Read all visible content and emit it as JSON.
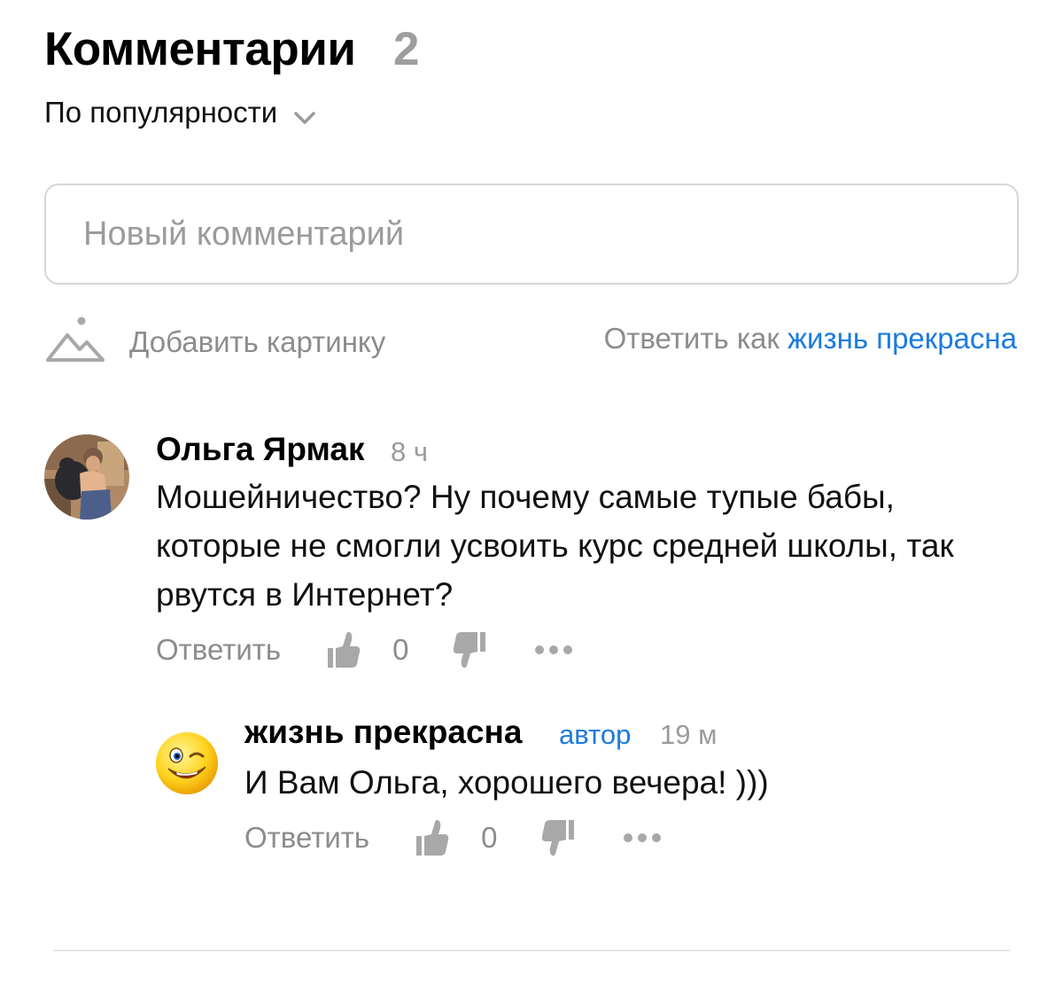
{
  "header": {
    "title": "Комментарии",
    "count": "2",
    "sort_label": "По популярности"
  },
  "composer": {
    "placeholder": "Новый комментарий",
    "add_picture_label": "Добавить картинку",
    "reply_as_prefix": "Ответить как",
    "reply_as_user": "жизнь прекрасна"
  },
  "comments": [
    {
      "author": "Ольга Ярмак",
      "time": "8 ч",
      "text": "Мошейничество? Ну почему самые тупые бабы, которые не смогли усвоить курс средней школы, так рвутся в Интернет?",
      "reply_label": "Ответить",
      "score": "0",
      "replies": [
        {
          "author": "жизнь прекрасна",
          "badge": "автор",
          "time": "19 м",
          "text": "И Вам Ольга, хорошего вечера! )))",
          "reply_label": "Ответить",
          "score": "0"
        }
      ]
    }
  ],
  "colors": {
    "accent": "#1a7be0",
    "muted": "#8c8c8c",
    "border": "#d7d7d7",
    "icon": "#a8a8a8"
  },
  "icons": [
    "chevron-down-icon",
    "mountain-image-icon",
    "thumb-up-icon",
    "thumb-down-icon",
    "more-dots-icon"
  ]
}
